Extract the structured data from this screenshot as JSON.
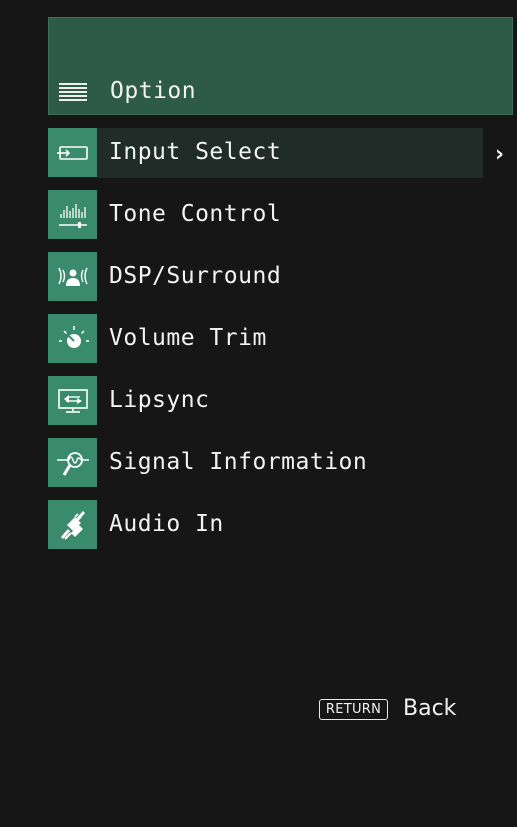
{
  "header": {
    "title": "Option",
    "icon": "list-icon"
  },
  "menu": {
    "items": [
      {
        "label": "Input Select",
        "icon": "input-select-icon",
        "selected": true
      },
      {
        "label": "Tone Control",
        "icon": "tone-control-icon"
      },
      {
        "label": "DSP/Surround",
        "icon": "dsp-surround-icon"
      },
      {
        "label": "Volume Trim",
        "icon": "volume-trim-icon"
      },
      {
        "label": "Lipsync",
        "icon": "lipsync-icon"
      },
      {
        "label": "Signal Information",
        "icon": "signal-information-icon"
      },
      {
        "label": "Audio In",
        "icon": "audio-in-icon"
      }
    ]
  },
  "footer": {
    "return_key": "RETURN",
    "back_label": "Back"
  },
  "colors": {
    "header_bg": "#2e5a48",
    "icon_bg": "#3a8a6e",
    "selected_bg": "#1f2c28",
    "page_bg": "#161616"
  }
}
